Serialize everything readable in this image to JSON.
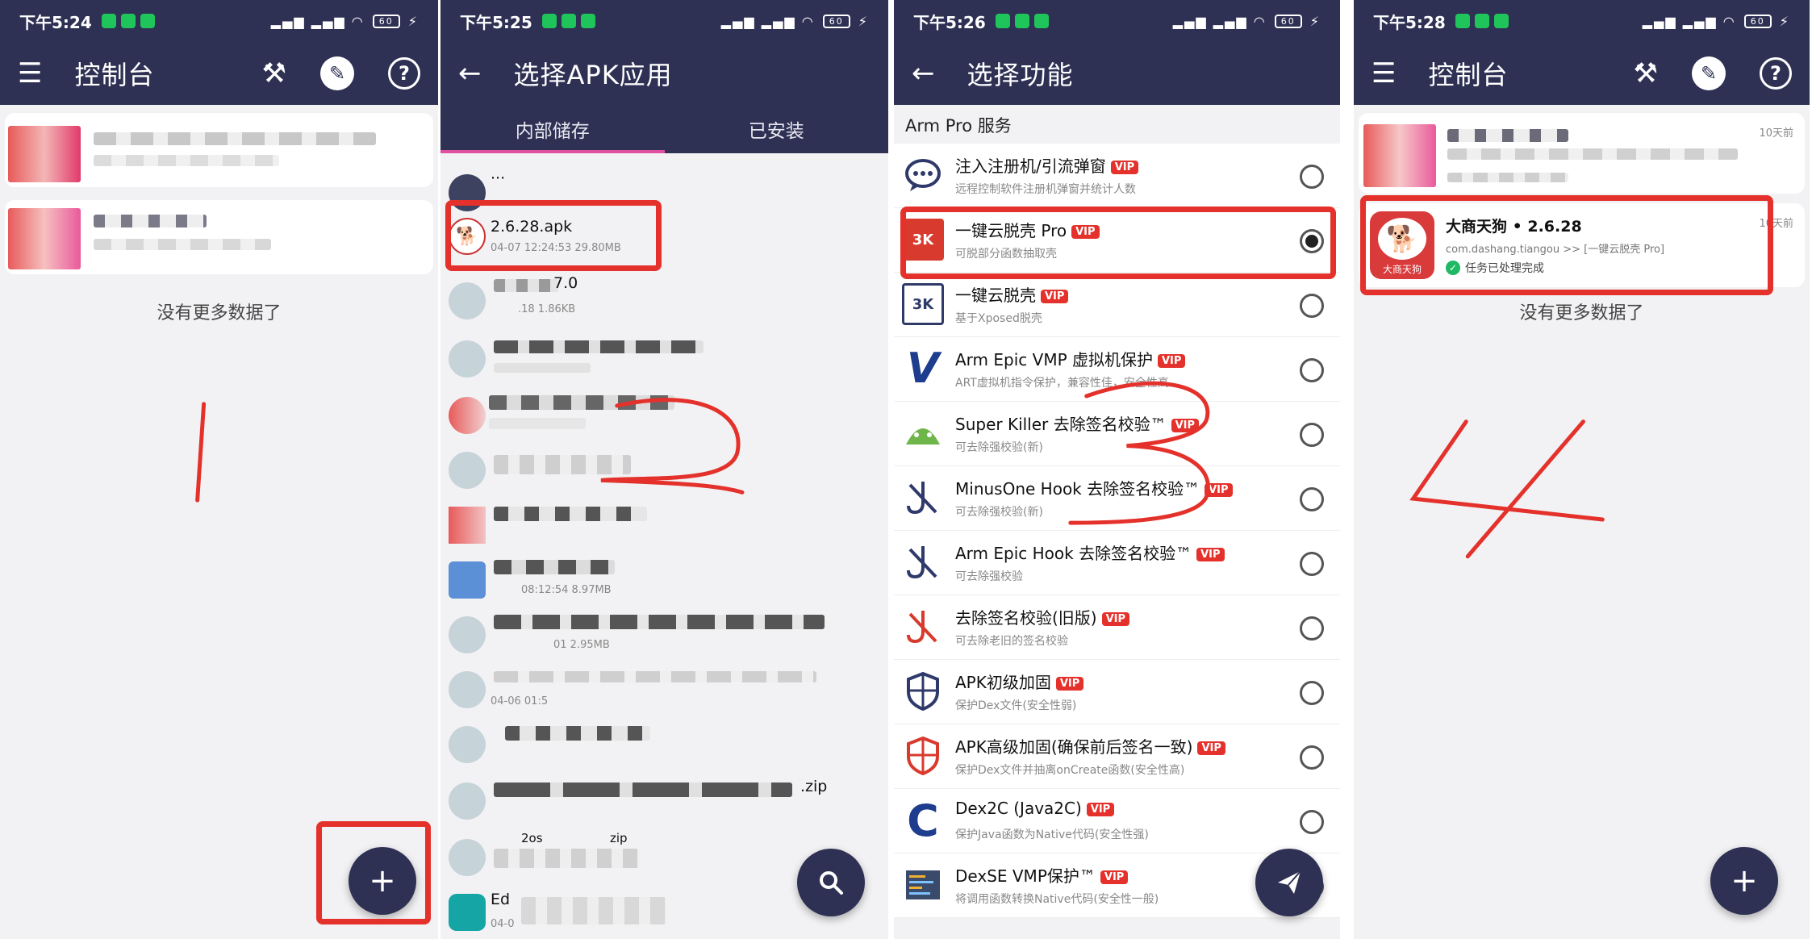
{
  "panel1": {
    "status_time": "下午5:24",
    "title": "控制台",
    "icons": [
      "menu-icon",
      "tools-icon",
      "guide-icon",
      "help-icon"
    ],
    "help_glyph": "?",
    "empty_text": "没有更多数据了",
    "fab": "+",
    "annotation": "1"
  },
  "panel2": {
    "status_time": "下午5:25",
    "title": "选择APK应用",
    "back": "←",
    "tabs": [
      "内部储存",
      "已安装"
    ],
    "parent_dir": "···",
    "highlight_file": {
      "name": "2.6.28.apk",
      "meta": "04-07 12:24:53 29.80MB"
    },
    "partial_texts": [
      "7.0",
      ".18 1.86KB",
      "08:12:54 8.97MB",
      "01 2.95MB",
      "04-06 01:5",
      ".zip",
      "Ed",
      "04-0",
      "2os",
      "zip"
    ],
    "search_fab": "search",
    "annotation": "2"
  },
  "panel3": {
    "status_time": "下午5:26",
    "title": "选择功能",
    "back": "←",
    "section": "Arm Pro 服务",
    "vip": "VIP",
    "items": [
      {
        "title": "注入注册机/引流弹窗",
        "sub": "远程控制软件注册机弹窗并统计人数",
        "icon": "chat-icon",
        "selected": false
      },
      {
        "title": "一键云脱壳 Pro",
        "sub": "可脱部分函数抽取壳",
        "icon": "unpack-pro-icon",
        "selected": true
      },
      {
        "title": "一键云脱壳",
        "sub": "基于Xposed脱壳",
        "icon": "unpack-icon",
        "selected": false
      },
      {
        "title": "Arm Epic VMP 虚拟机保护",
        "sub": "ART虚拟机指令保护，兼容性佳，安全性高",
        "icon": "vmp-icon",
        "selected": false
      },
      {
        "title": "Super Killer 去除签名校验™",
        "sub": "可去除强校验(新)",
        "icon": "android-icon",
        "selected": false
      },
      {
        "title": "MinusOne Hook 去除签名校验™",
        "sub": "可去除强校验(新)",
        "icon": "hook-icon",
        "selected": false
      },
      {
        "title": "Arm Epic Hook 去除签名校验™",
        "sub": "可去除强校验",
        "icon": "hook-icon",
        "selected": false
      },
      {
        "title": "去除签名校验(旧版)",
        "sub": "可去除老旧的签名校验",
        "icon": "hook-old-icon",
        "selected": false
      },
      {
        "title": "APK初级加固",
        "sub": "保护Dex文件(安全性弱)",
        "icon": "shield-icon",
        "selected": false
      },
      {
        "title": "APK高级加固(确保前后签名一致)",
        "sub": "保护Dex文件并抽离onCreate函数(安全性高)",
        "icon": "shield-red-icon",
        "selected": false
      },
      {
        "title": "Dex2C (Java2C)",
        "sub": "保护Java函数为Native代码(安全性强)",
        "icon": "c-icon",
        "selected": false
      },
      {
        "title": "DexSE VMP保护™",
        "sub": "将调用函数转换Native代码(安全性一般)",
        "icon": "code-icon",
        "selected": false
      }
    ],
    "send_fab": "send",
    "annotation": "3"
  },
  "panel4": {
    "status_time": "下午5:28",
    "title": "控制台",
    "help_glyph": "?",
    "card_time_1": "10天前",
    "task": {
      "app_name": "大商天狗 • 2.6.28",
      "package": "com.dashang.tiangou >> [一键云脱壳 Pro]",
      "status": "任务已处理完成",
      "time": "10天前",
      "icon_label": "大商天狗"
    },
    "empty_text": "没有更多数据了",
    "fab": "+",
    "annotation": "4"
  },
  "colors": {
    "header": "#2f3154",
    "accent": "#e14fa0",
    "highlight": "#e4312b",
    "vip": "#e4312b",
    "success": "#1fb864"
  }
}
